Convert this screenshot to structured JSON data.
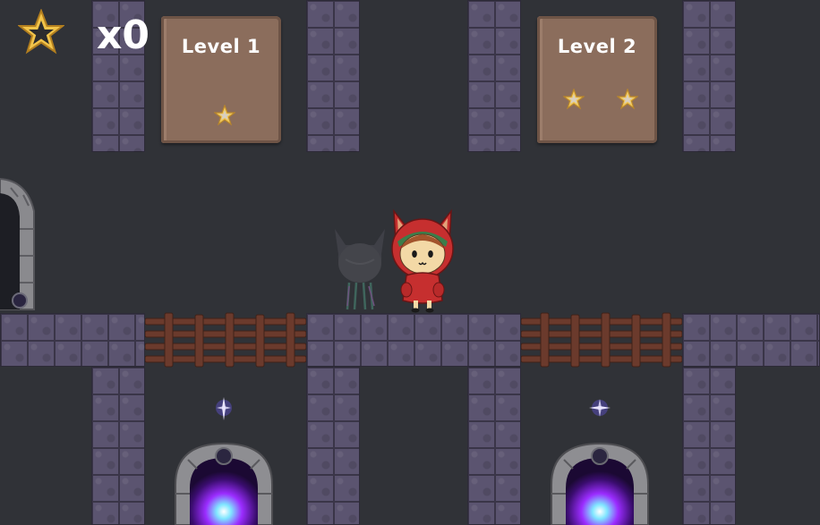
{
  "hud": {
    "star_icon": "star-icon",
    "star_count": "x0"
  },
  "levels": [
    {
      "title": "Level 1",
      "stars": 1
    },
    {
      "title": "Level 2",
      "stars": 2
    }
  ],
  "colors": {
    "background": "#303237",
    "stone": "#5b5470",
    "sign": "#8b6d5c",
    "star_gold": "#e9b43a",
    "portal": "#9b2cff"
  }
}
